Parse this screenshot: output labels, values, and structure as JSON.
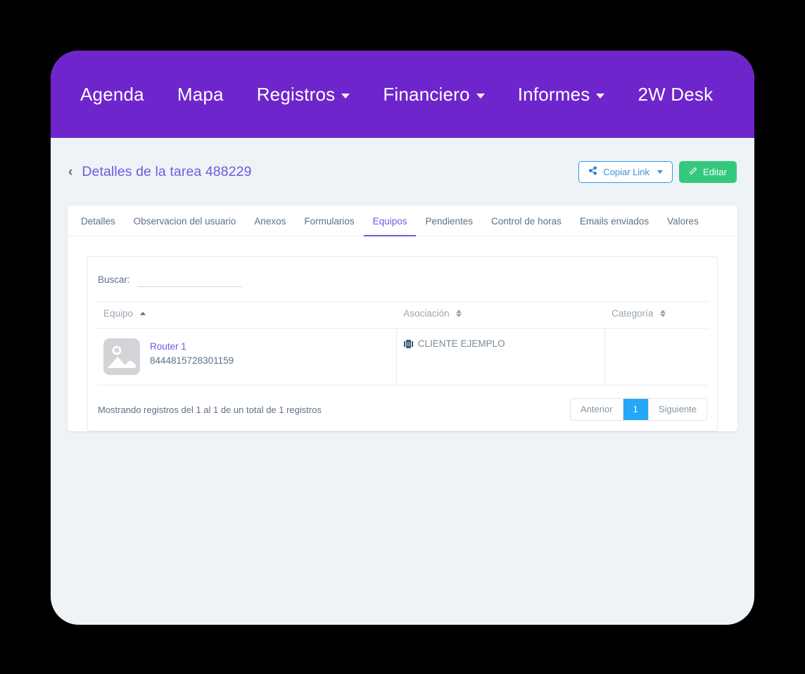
{
  "topnav": {
    "items": [
      {
        "label": "Agenda",
        "has_caret": false
      },
      {
        "label": "Mapa",
        "has_caret": false
      },
      {
        "label": "Registros",
        "has_caret": true
      },
      {
        "label": "Financiero",
        "has_caret": true
      },
      {
        "label": "Informes",
        "has_caret": true
      },
      {
        "label": "2W Desk",
        "has_caret": false
      }
    ],
    "background_color": "#6f25cc"
  },
  "page": {
    "back_chevron": "‹",
    "title": "Detalles de la tarea 488229",
    "title_color": "#7159e0",
    "actions": {
      "copy_link_label": "Copiar Link",
      "copy_link_icon": "share-icon",
      "edit_label": "Editar",
      "edit_icon": "pencil-icon",
      "edit_color": "#34c87f"
    }
  },
  "tabs": [
    {
      "label": "Detalles",
      "active": false
    },
    {
      "label": "Observacion del usuario",
      "active": false
    },
    {
      "label": "Anexos",
      "active": false
    },
    {
      "label": "Formularios",
      "active": false
    },
    {
      "label": "Equipos",
      "active": true
    },
    {
      "label": "Pendientes",
      "active": false
    },
    {
      "label": "Control de horas",
      "active": false
    },
    {
      "label": "Emails enviados",
      "active": false
    },
    {
      "label": "Valores",
      "active": false
    }
  ],
  "search": {
    "label": "Buscar:",
    "value": "",
    "placeholder": ""
  },
  "table": {
    "columns": [
      {
        "label": "Equipo",
        "sort": "asc"
      },
      {
        "label": "Asociación",
        "sort": "none"
      },
      {
        "label": "Categoría",
        "sort": "none"
      }
    ],
    "rows": [
      {
        "thumb_icon": "image-placeholder-icon",
        "equipo_name": "Router 1",
        "equipo_serial": "8444815728301159",
        "asociacion_icon": "company-icon",
        "asociacion": "CLIENTE EJEMPLO",
        "categoria": ""
      }
    ]
  },
  "footer": {
    "showing_text": "Mostrando registros del 1 al 1 de un total de 1 registros",
    "pagination": [
      {
        "label": "Anterior",
        "active": false
      },
      {
        "label": "1",
        "active": true
      },
      {
        "label": "Siguiente",
        "active": false
      }
    ],
    "active_page_color": "#26a6f7"
  }
}
